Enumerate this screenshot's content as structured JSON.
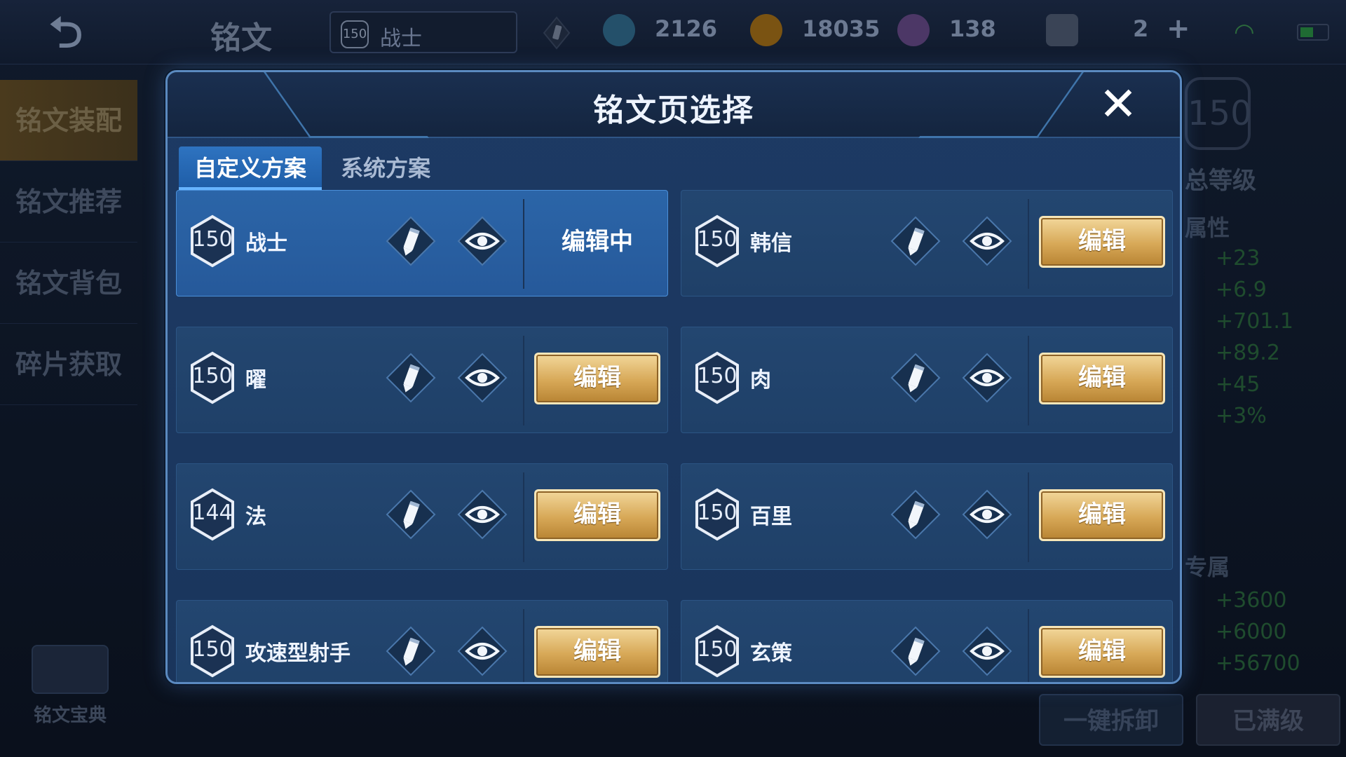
{
  "topbar": {
    "title": "铭文",
    "page_select": {
      "level": "150",
      "name": "战士"
    },
    "currencies": [
      {
        "icon": "crystal-icon",
        "value": "2126",
        "color": "#2a6f86"
      },
      {
        "icon": "gold-coin-icon",
        "value": "18035",
        "color": "#8a5a14"
      },
      {
        "icon": "gem-chest-icon",
        "value": "138",
        "color": "#5a3f78"
      },
      {
        "icon": "card-icon",
        "value": "2",
        "color": "#4a5566"
      }
    ],
    "add_label": "+"
  },
  "left_nav": {
    "items": [
      {
        "label": "铭文装配",
        "active": true
      },
      {
        "label": "铭文推荐",
        "active": false
      },
      {
        "label": "铭文背包",
        "active": false
      },
      {
        "label": "碎片获取",
        "active": false
      }
    ],
    "codex_label": "铭文宝典"
  },
  "right_panel": {
    "level": "150",
    "total_level_label": "总等级",
    "attr_label": "属性",
    "attr_values": [
      "+23",
      "+6.9",
      "+701.1",
      "+89.2",
      "+45",
      "+3%"
    ],
    "exclusive_label": "专属",
    "exclusive_values": [
      "+3600",
      "+6000",
      "+56700"
    ],
    "dismantle_label": "一键拆卸",
    "maxed_label": "已满级"
  },
  "modal": {
    "title": "铭文页选择",
    "close_icon": "close-icon",
    "tabs": [
      {
        "label": "自定义方案",
        "active": true
      },
      {
        "label": "系统方案",
        "active": false
      }
    ],
    "edit_label": "编辑",
    "editing_label": "编辑中",
    "pages": [
      {
        "level": "150",
        "name": "战士",
        "editing": true
      },
      {
        "level": "150",
        "name": "韩信",
        "editing": false
      },
      {
        "level": "150",
        "name": "曜",
        "editing": false
      },
      {
        "level": "150",
        "name": "肉",
        "editing": false
      },
      {
        "level": "144",
        "name": "法",
        "editing": false
      },
      {
        "level": "150",
        "name": "百里",
        "editing": false
      },
      {
        "level": "150",
        "name": "攻速型射手",
        "editing": false
      },
      {
        "level": "150",
        "name": "玄策",
        "editing": false
      }
    ]
  }
}
